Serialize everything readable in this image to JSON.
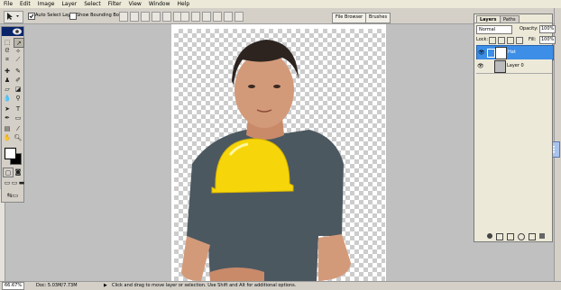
{
  "menu": [
    "File",
    "Edit",
    "Image",
    "Layer",
    "Select",
    "Filter",
    "View",
    "Window",
    "Help"
  ],
  "options": {
    "auto_select_label": "Auto Select Layer",
    "bounding_box_label": "Show Bounding Box",
    "palette_tabs": [
      "File Browser",
      "Brushes"
    ]
  },
  "layers_panel": {
    "tabs": [
      "Layers",
      "Paths"
    ],
    "blend_mode": "Normal",
    "opacity_label": "Opacity:",
    "opacity_value": "100%",
    "lock_label": "Lock:",
    "fill_label": "Fill:",
    "fill_value": "100%",
    "layers": [
      {
        "name": "Hat",
        "selected": true
      },
      {
        "name": "Layer 0",
        "selected": false
      }
    ]
  },
  "status": {
    "zoom": "66.67%",
    "doc": "Doc: 5.03M/7.73M",
    "hint": "Click and drag to move layer or selection.  Use Shift and Alt for additional options."
  },
  "colors": {
    "hat": "#f6d60a",
    "selection": "#3d8ee6",
    "shirt": "#4c5860"
  }
}
